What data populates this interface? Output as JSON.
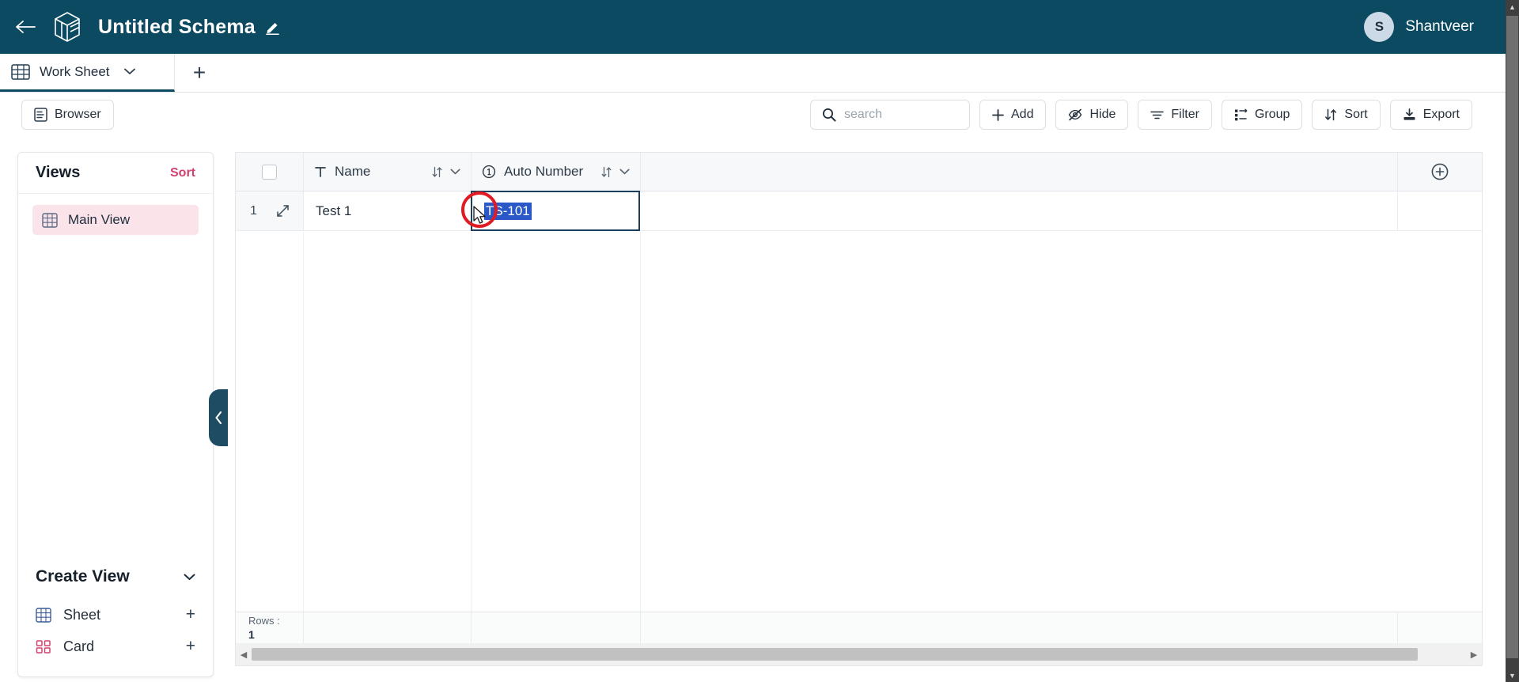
{
  "header": {
    "back_icon": "arrow-left-icon",
    "logo_icon": "cube-logo-icon",
    "title": "Untitled Schema",
    "edit_icon": "pencil-icon",
    "user": {
      "initial": "S",
      "name": "Shantveer",
      "avatar_color": "#ccd9e6"
    }
  },
  "tabbar": {
    "tab_icon": "table-icon",
    "tab_label": "Work Sheet",
    "caret_icon": "chevron-down-icon",
    "add_tab_label": "+"
  },
  "toolbar": {
    "browser_label": "Browser",
    "browser_icon": "browser-panel-icon",
    "search": {
      "value": "",
      "placeholder": "search",
      "icon": "search-icon"
    },
    "buttons": [
      {
        "label": "Add",
        "icon": "plus-icon"
      },
      {
        "label": "Hide",
        "icon": "eye-off-icon"
      },
      {
        "label": "Filter",
        "icon": "filter-icon"
      },
      {
        "label": "Group",
        "icon": "group-icon"
      },
      {
        "label": "Sort",
        "icon": "sort-arrows-icon"
      },
      {
        "label": "Export",
        "icon": "download-icon"
      }
    ]
  },
  "sidebar": {
    "views_title": "Views",
    "views_sort_label": "Sort",
    "views": [
      {
        "label": "Main View",
        "icon": "grid-icon",
        "active": true
      }
    ],
    "create_view": {
      "title": "Create View",
      "caret_icon": "chevron-down-icon",
      "items": [
        {
          "label": "Sheet",
          "icon": "grid-icon",
          "add": "+"
        },
        {
          "label": "Card",
          "icon": "cards-icon",
          "add": "+"
        }
      ]
    },
    "collapse_icon": "chevron-left-icon"
  },
  "grid": {
    "columns": [
      {
        "label": "Name",
        "type_icon": "text-type-icon",
        "sort_icon": "sort-arrows-icon",
        "menu_icon": "chevron-down-icon"
      },
      {
        "label": "Auto Number",
        "type_icon": "auto-number-icon",
        "sort_icon": "sort-arrows-icon",
        "menu_icon": "chevron-down-icon"
      }
    ],
    "add_field_icon": "plus-circle-icon",
    "rows": [
      {
        "number": "1",
        "expand_icon": "expand-icon",
        "name": "Test 1",
        "auto_number": "TS-101",
        "selected_cell": "auto_number"
      }
    ],
    "footer": {
      "rows_label": "Rows :",
      "rows_count": "1"
    },
    "selection_color": "#2a58c6",
    "active_cell_border": "#1b3f5e"
  },
  "annotation": {
    "shape": "circle",
    "color": "#e01b24"
  }
}
